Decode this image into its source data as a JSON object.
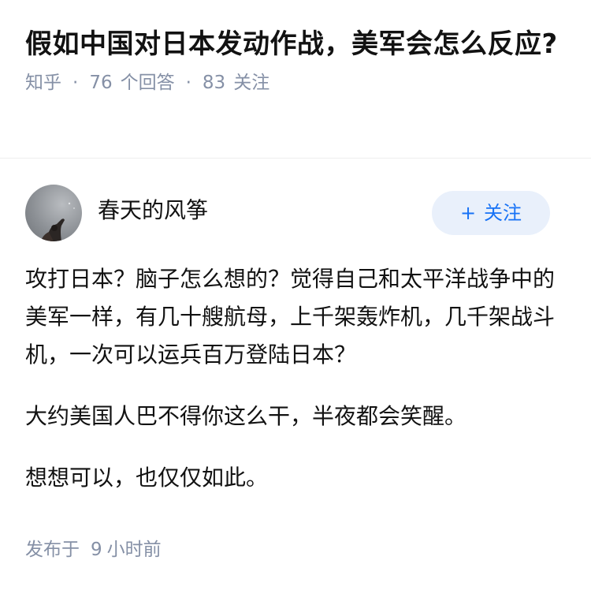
{
  "question": {
    "title": "假如中国对日本发动作战，美军会怎么反应?",
    "source": "知乎",
    "answer_count": "76",
    "answer_label": "个回答",
    "follower_count": "83",
    "follower_label": "关注"
  },
  "answer": {
    "author_name": "春天的风筝",
    "follow_button": "关注",
    "follow_icon": "plus-icon",
    "paragraphs": [
      "攻打日本？脑子怎么想的？觉得自己和太平洋战争中的美军一样，有几十艘航母，上千架轰炸机，几千架战斗机，一次可以运兵百万登陆日本？",
      "大约美国人巴不得你这么干，半夜都会笑醒。",
      "想想可以，也仅仅如此。"
    ],
    "posted_label": "发布于",
    "posted_num": "9",
    "posted_unit": "小时前"
  },
  "colors": {
    "meta_gray": "#8590a6",
    "accent_blue": "#1772f6",
    "button_bg": "#e9f0fb",
    "text": "#121212"
  }
}
